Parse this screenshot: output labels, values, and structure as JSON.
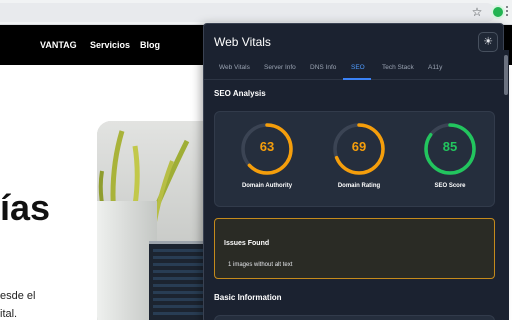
{
  "browser": {
    "star_icon": "star-icon",
    "extension_icon": "web-vitals-extension-icon",
    "extension_color": "#22b452"
  },
  "site": {
    "nav": [
      "VANTAG",
      "Servicios",
      "Blog"
    ],
    "hero_title": "ías",
    "hero_text_1": "esde el",
    "hero_text_2": "ital."
  },
  "popup": {
    "title": "Web Vitals",
    "settings_icon": "gear-icon",
    "tabs": [
      {
        "label": "Web Vitals",
        "active": false
      },
      {
        "label": "Server Info",
        "active": false
      },
      {
        "label": "DNS Info",
        "active": false
      },
      {
        "label": "SEO",
        "active": true
      },
      {
        "label": "Tech Stack",
        "active": false
      },
      {
        "label": "A11y",
        "active": false
      }
    ],
    "seo": {
      "heading": "SEO Analysis",
      "scores": [
        {
          "label": "Domain Authority",
          "value": "63",
          "percent": 63,
          "color": "#f59e0b"
        },
        {
          "label": "Domain Rating",
          "value": "69",
          "percent": 69,
          "color": "#f59e0b"
        },
        {
          "label": "SEO Score",
          "value": "85",
          "percent": 85,
          "color": "#22c55e"
        }
      ],
      "issues": {
        "title": "Issues Found",
        "items": [
          "1 images without alt text"
        ],
        "border_color": "#c48a1c"
      },
      "basic_heading": "Basic Information"
    }
  }
}
